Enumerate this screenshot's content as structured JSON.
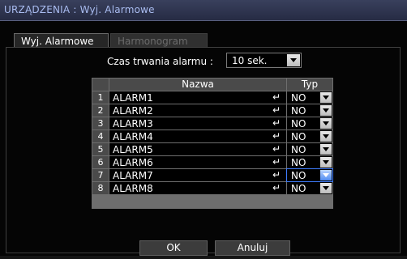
{
  "window": {
    "title": "URZĄDZENIA : Wyj. Alarmowe"
  },
  "tabs": [
    {
      "label": "Wyj. Alarmowe",
      "active": true
    },
    {
      "label": "Harmonogram",
      "active": false
    }
  ],
  "duration": {
    "label": "Czas trwania alarmu :",
    "value": "10 sek."
  },
  "table": {
    "headers": {
      "number": "",
      "name": "Nazwa",
      "type": "Typ"
    },
    "rows": [
      {
        "num": "1",
        "name": "ALARM1",
        "type": "NO"
      },
      {
        "num": "2",
        "name": "ALARM2",
        "type": "NO"
      },
      {
        "num": "3",
        "name": "ALARM3",
        "type": "NO"
      },
      {
        "num": "4",
        "name": "ALARM4",
        "type": "NO"
      },
      {
        "num": "5",
        "name": "ALARM5",
        "type": "NO"
      },
      {
        "num": "6",
        "name": "ALARM6",
        "type": "NO"
      },
      {
        "num": "7",
        "name": "ALARM7",
        "type": "NO",
        "selected": true
      },
      {
        "num": "8",
        "name": "ALARM8",
        "type": "NO"
      }
    ]
  },
  "buttons": {
    "ok": "OK",
    "cancel": "Anuluj"
  },
  "icons": {
    "enter": "enter-icon",
    "dropdown": "chevron-down-icon"
  },
  "colors": {
    "title_text": "#a9bcf0",
    "selection_accent": "#3f7dff"
  }
}
